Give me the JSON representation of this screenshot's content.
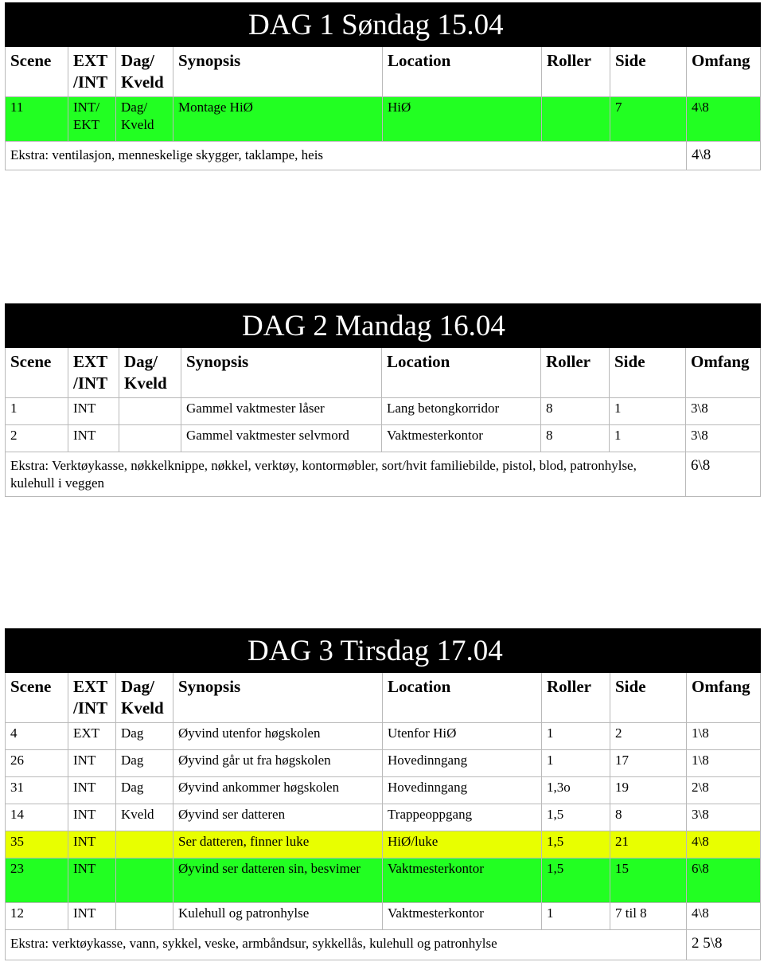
{
  "columns": [
    "Scene",
    "EXT /INT",
    "Dag/ Kveld",
    "Synopsis",
    "Location",
    "Roller",
    "Side",
    "Omfang"
  ],
  "days": [
    {
      "title": "DAG 1 Søndag 15.04",
      "rows": [
        {
          "scene": "11",
          "extint": "INT/ EKT",
          "dagkveld": "Dag/ Kveld",
          "synopsis": "Montage HiØ",
          "location": "HiØ",
          "roller": "",
          "side": "7",
          "omfang": "4\\8",
          "highlight": "green"
        }
      ],
      "extra": "Ekstra: ventilasjon, menneskelige skygger, taklampe, heis",
      "total": "4\\8"
    },
    {
      "title": "DAG 2 Mandag 16.04",
      "rows": [
        {
          "scene": "1",
          "extint": "INT",
          "dagkveld": "",
          "synopsis": "Gammel vaktmester låser",
          "location": "Lang betongkorridor",
          "roller": "8",
          "side": "1",
          "omfang": "3\\8",
          "highlight": ""
        },
        {
          "scene": "2",
          "extint": "INT",
          "dagkveld": "",
          "synopsis": "Gammel vaktmester selvmord",
          "location": "Vaktmesterkontor",
          "roller": "8",
          "side": "1",
          "omfang": "3\\8",
          "highlight": ""
        }
      ],
      "extra": "Ekstra: Verktøykasse, nøkkelknippe, nøkkel, verktøy, kontormøbler, sort/hvit familiebilde, pistol, blod, patronhylse, kulehull i veggen",
      "total": "6\\8"
    },
    {
      "title": "DAG 3 Tirsdag 17.04",
      "rows": [
        {
          "scene": "4",
          "extint": "EXT",
          "dagkveld": "Dag",
          "synopsis": "Øyvind utenfor høgskolen",
          "location": "Utenfor HiØ",
          "roller": "1",
          "side": "2",
          "omfang": "1\\8",
          "highlight": ""
        },
        {
          "scene": "26",
          "extint": "INT",
          "dagkveld": "Dag",
          "synopsis": "Øyvind går ut fra høgskolen",
          "location": "Hovedinngang",
          "roller": "1",
          "side": "17",
          "omfang": "1\\8",
          "highlight": ""
        },
        {
          "scene": "31",
          "extint": "INT",
          "dagkveld": "Dag",
          "synopsis": "Øyvind ankommer høgskolen",
          "location": "Hovedinngang",
          "roller": "1,3o",
          "side": "19",
          "omfang": "2\\8",
          "highlight": ""
        },
        {
          "scene": "14",
          "extint": "INT",
          "dagkveld": "Kveld",
          "synopsis": "Øyvind ser datteren",
          "location": "Trappeoppgang",
          "roller": "1,5",
          "side": "8",
          "omfang": "3\\8",
          "highlight": ""
        },
        {
          "scene": "35",
          "extint": "INT",
          "dagkveld": "",
          "synopsis": "Ser datteren, finner luke",
          "location": "HiØ/luke",
          "roller": "1,5",
          "side": "21",
          "omfang": "4\\8",
          "highlight": "yellow"
        },
        {
          "scene": "23",
          "extint": "INT",
          "dagkveld": "",
          "synopsis": "Øyvind ser datteren sin, besvimer",
          "location": "Vaktmesterkontor",
          "roller": "1,5",
          "side": "15",
          "omfang": "6\\8",
          "highlight": "green"
        },
        {
          "scene": "12",
          "extint": "INT",
          "dagkveld": "",
          "synopsis": "Kulehull og patronhylse",
          "location": "Vaktmesterkontor",
          "roller": "1",
          "side": "7 til 8",
          "omfang": "4\\8",
          "highlight": ""
        }
      ],
      "extra": "Ekstra: verktøykasse, vann, sykkel, veske, armbåndsur, sykkellås, kulehull og patronhylse",
      "total": "2 5\\8"
    }
  ],
  "colors": {
    "title_bg": "#000000",
    "green_highlight": "#22ff22",
    "yellow_highlight": "#e8ff00"
  }
}
